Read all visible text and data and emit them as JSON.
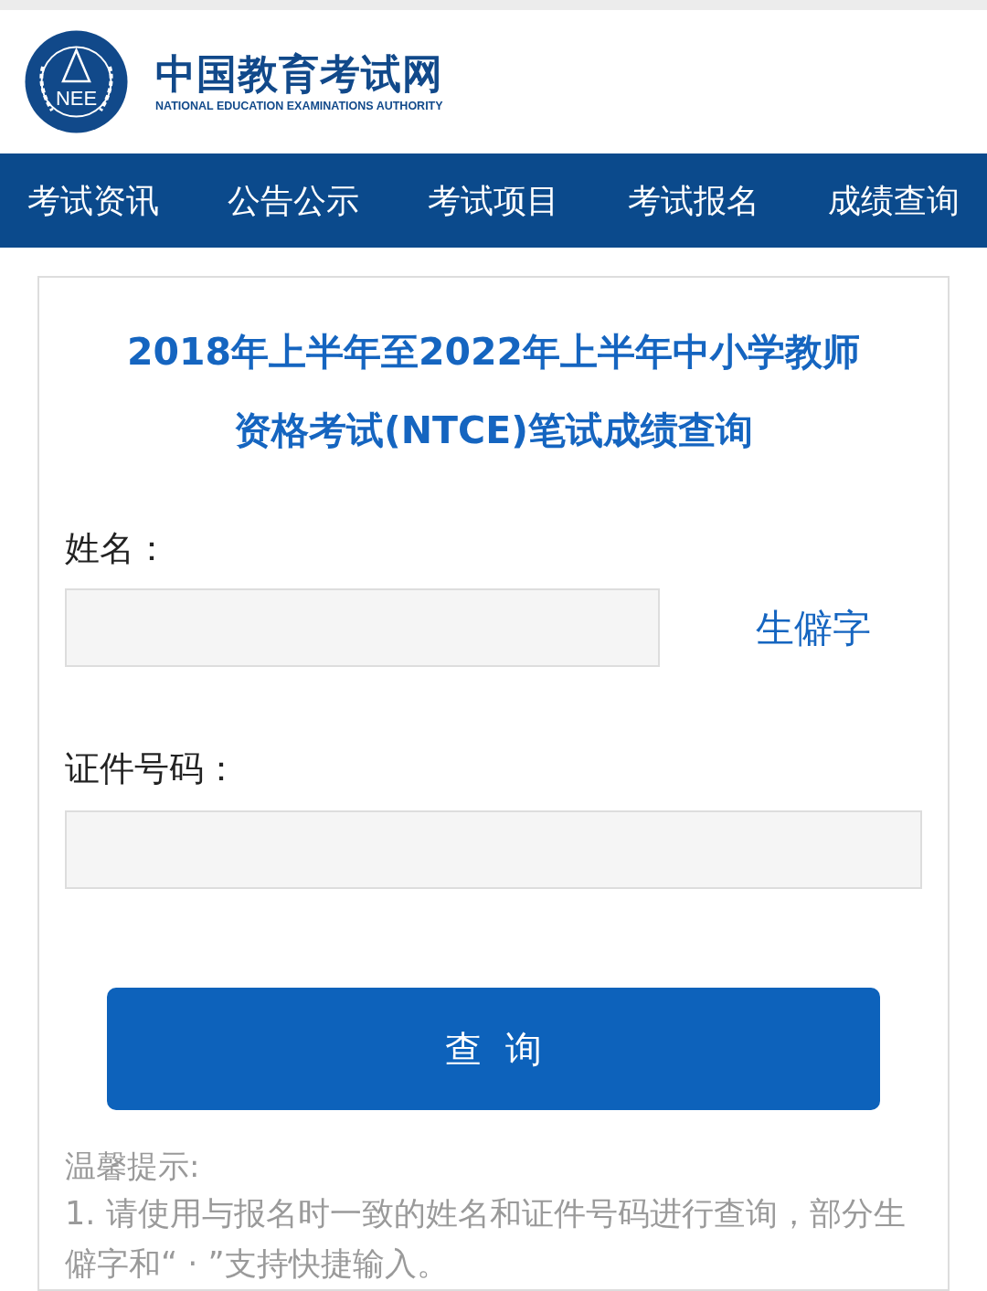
{
  "header": {
    "emblem_text": "NEE",
    "site_name": "中国教育考试网",
    "site_name_en": "NATIONAL EDUCATION EXAMINATIONS AUTHORITY"
  },
  "nav": [
    {
      "label": "考试资讯"
    },
    {
      "label": "公告公示"
    },
    {
      "label": "考试项目"
    },
    {
      "label": "考试报名"
    },
    {
      "label": "成绩查询"
    }
  ],
  "form": {
    "title_lines": [
      "2018年上半年至2022年上半年中小学教师",
      "资格考试(NTCE)笔试成绩查询"
    ],
    "name_label": "姓名：",
    "rare_char_link": "生僻字",
    "id_label": "证件号码：",
    "submit": "查  询"
  },
  "tips": {
    "heading": "温馨提示:",
    "items": [
      "1. 请使用与报名时一致的姓名和证件号码进行查询，部分生僻字和“ · ”支持快捷输入。"
    ]
  }
}
